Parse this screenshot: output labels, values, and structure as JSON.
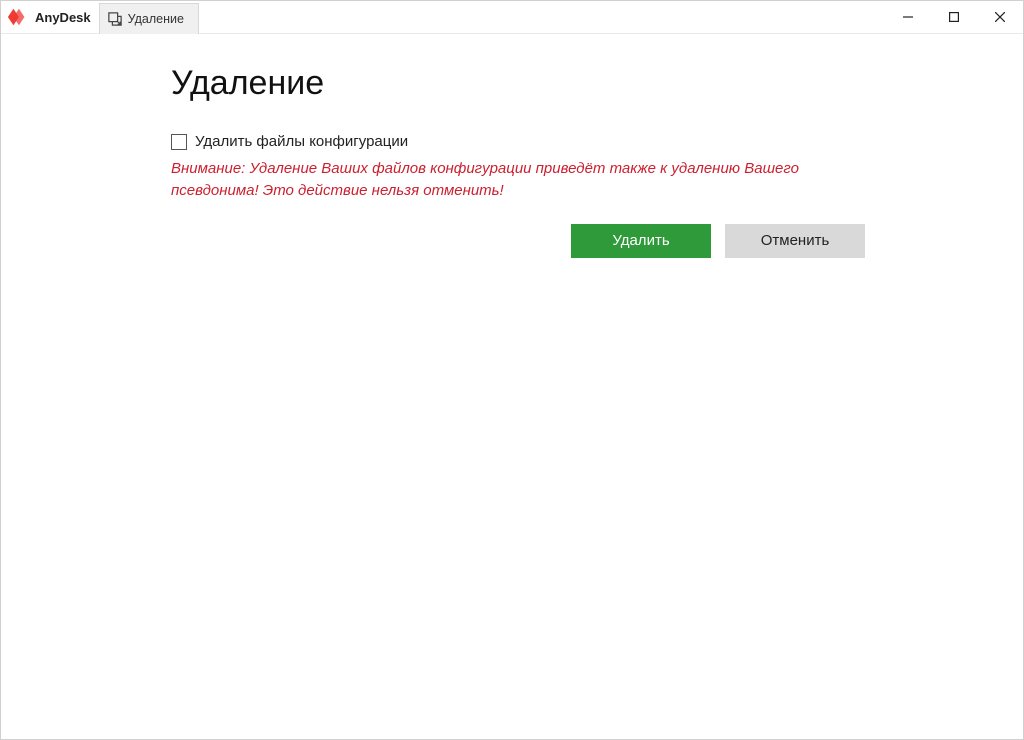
{
  "app": {
    "name": "AnyDesk"
  },
  "tab": {
    "label": "Удаление"
  },
  "window_controls": {
    "minimize": "—",
    "maximize": "☐",
    "close": "✕"
  },
  "main": {
    "heading": "Удаление",
    "checkbox_label": "Удалить файлы конфигурации",
    "checkbox_checked": false,
    "warning": "Внимание: Удаление Ваших файлов конфигурации приведёт также к удалению Вашего псевдонима! Это действие нельзя отменить!",
    "buttons": {
      "primary": "Удалить",
      "secondary": "Отменить"
    }
  },
  "colors": {
    "brand": "#ef3b33",
    "primary_button": "#2e9a3a",
    "warning_text": "#cc1f2f"
  }
}
